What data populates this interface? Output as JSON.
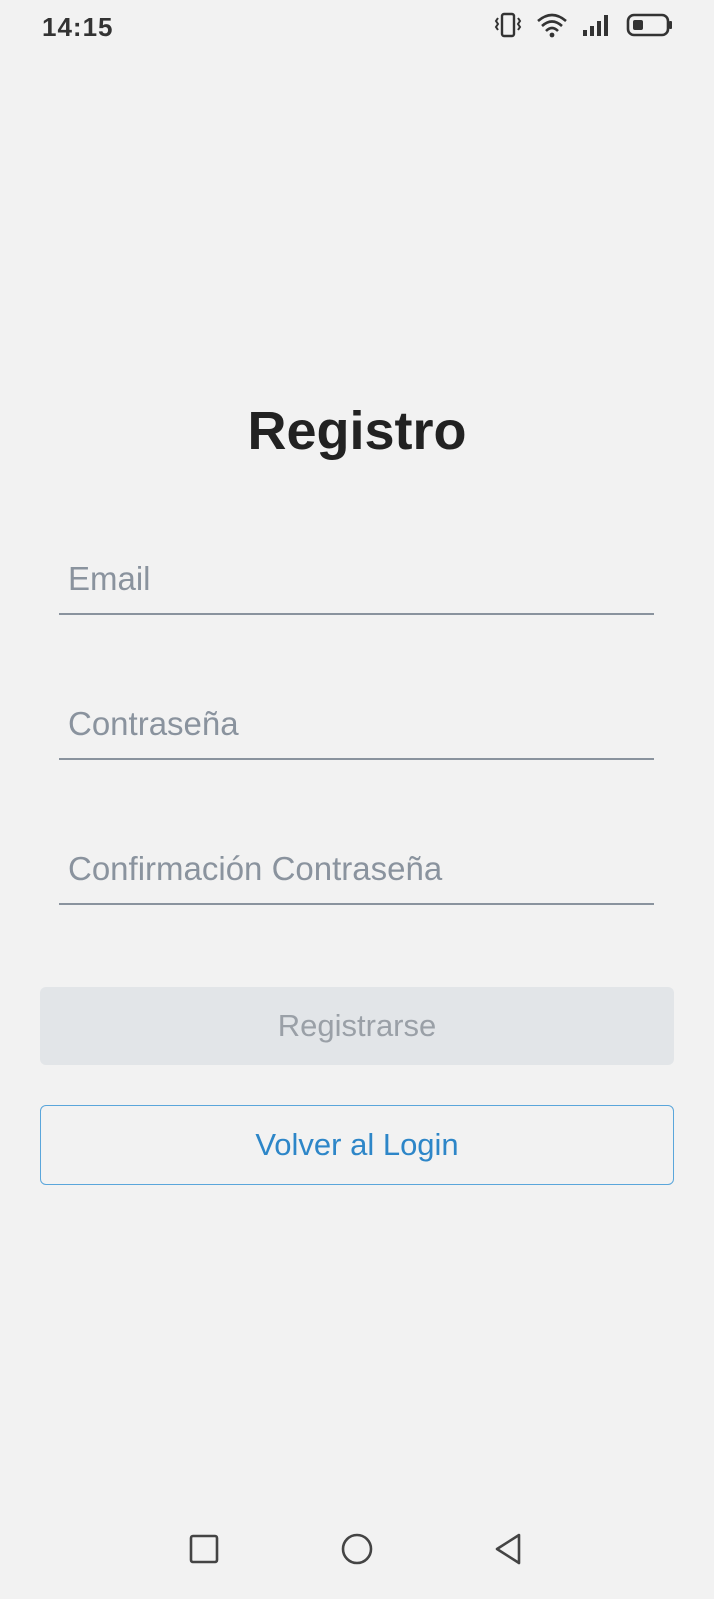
{
  "status_bar": {
    "time": "14:15",
    "icons": [
      "vibrate-icon",
      "wifi-icon",
      "signal-icon",
      "battery-icon"
    ]
  },
  "page": {
    "title": "Registro"
  },
  "form": {
    "email_placeholder": "Email",
    "email_value": "",
    "password_placeholder": "Contraseña",
    "password_value": "",
    "confirm_placeholder": "Confirmación Contraseña",
    "confirm_value": ""
  },
  "actions": {
    "register_label": "Registrarse",
    "back_label": "Volver al Login"
  },
  "nav_bar": {
    "buttons": [
      "recent-apps-icon",
      "home-icon",
      "back-icon"
    ]
  },
  "colors": {
    "background": "#f2f2f2",
    "placeholder": "#8a939e",
    "disabled_button_bg": "#e2e5e8",
    "disabled_button_text": "#9aa0a7",
    "link_blue": "#2d86c8"
  }
}
